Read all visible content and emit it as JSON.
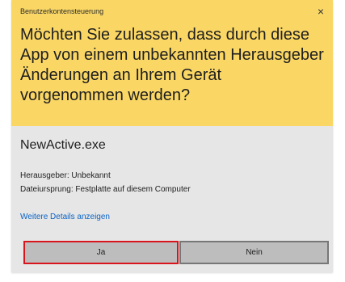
{
  "dialog": {
    "title": "Benutzerkontensteuerung",
    "close_symbol": "×",
    "question": "Möchten Sie zulassen, dass durch diese App von einem unbekannten Herausgeber Änderungen an Ihrem Gerät vorgenommen werden?",
    "app_name": "NewActive.exe",
    "publisher_line": "Herausgeber: Unbekannt",
    "origin_line": "Dateiursprung: Festplatte auf diesem Computer",
    "details_link": "Weitere Details anzeigen",
    "buttons": {
      "yes": "Ja",
      "no": "Nein"
    }
  },
  "colors": {
    "header": "#fad765",
    "body": "#e6e6e6",
    "link": "#0a63c5",
    "highlight": "#d8141c"
  },
  "icons": {
    "close": "close-icon"
  }
}
